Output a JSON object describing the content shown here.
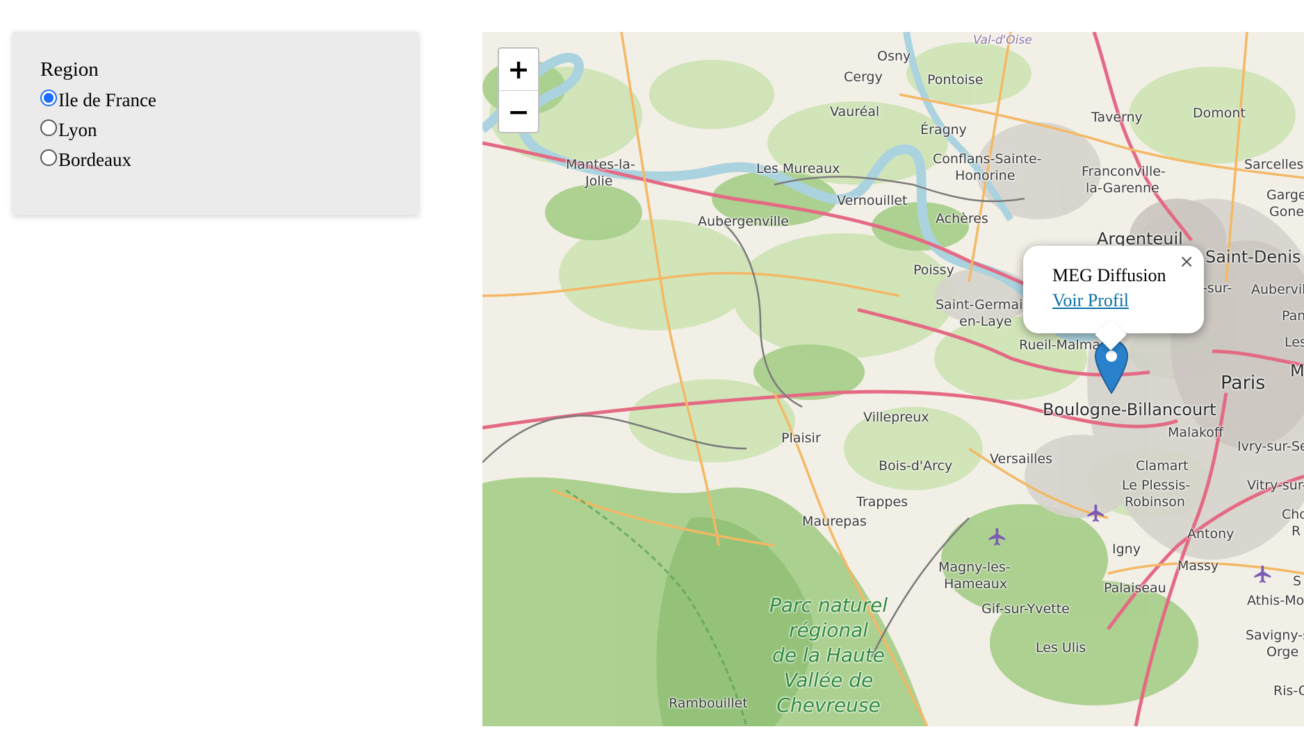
{
  "panel": {
    "title": "Region",
    "options": [
      {
        "label": "Ile de France",
        "checked": true
      },
      {
        "label": "Lyon",
        "checked": false
      },
      {
        "label": "Bordeaux",
        "checked": false
      }
    ]
  },
  "map": {
    "zoom_in": "+",
    "zoom_out": "−",
    "places": {
      "val_doise": "Val-d'Oise",
      "osny": "Osny",
      "cergy": "Cergy",
      "pontoise": "Pontoise",
      "vaureal": "Vauréal",
      "eragny": "Éragny",
      "taverny": "Taverny",
      "domont": "Domont",
      "sarcelles": "Sarcelles",
      "garges": "Garges",
      "gones": "Gones",
      "mantes1": "Mantes-la-",
      "mantes2": "Jolie",
      "les_mureaux": "Les Mureaux",
      "conflans1": "Conflans-Sainte-",
      "conflans2": "Honorine",
      "franconville1": "Franconville-",
      "franconville2": "la-Garenne",
      "vernouillet": "Vernouillet",
      "aubergenville": "Aubergenville",
      "acheres": "Achères",
      "argenteuil": "Argenteuil",
      "saint_denis": "Saint-Denis",
      "poissy": "Poissy",
      "sur": "-sur-",
      "aubervilliers": "Aubervillie",
      "saint_germain1": "Saint-Germai",
      "saint_germain2": "en-Laye",
      "pant": "Pant",
      "rueil": "Rueil-Malmai",
      "les": "Les",
      "paris": "Paris",
      "m": "M",
      "boulogne": "Boulogne-Billancourt",
      "villepreux": "Villepreux",
      "malakoff": "Malakoff",
      "plaisir": "Plaisir",
      "ivry": "Ivry-sur-Se",
      "versailles": "Versailles",
      "clamart": "Clamart",
      "bois_darcy": "Bois-d'Arcy",
      "le_plessis1": "Le Plessis-",
      "le_plessis2": "Robinson",
      "vitry": "Vitry-sur-S",
      "trappes": "Trappes",
      "choisy1": "Chois",
      "choisy2": "R",
      "maurepas": "Maurepas",
      "antony": "Antony",
      "igny": "Igny",
      "massy": "Massy",
      "magny1": "Magny-les-",
      "magny2": "Hameaux",
      "palaiseau": "Palaiseau",
      "athis": "Athis-Mo",
      "s": "S",
      "gif": "Gif-sur-Yvette",
      "savigny1": "Savigny-sur-",
      "savigny2": "Orge",
      "les_ulis": "Les Ulis",
      "ris": "Ris-O",
      "rambouillet": "Rambouillet",
      "park1": "Parc naturel",
      "park2": "régional",
      "park3": "de la Haute",
      "park4": "Vallée de",
      "park5": "Chevreuse"
    }
  },
  "popup": {
    "title": "MEG Diffusion",
    "link": "Voir Profil",
    "close": "×"
  }
}
